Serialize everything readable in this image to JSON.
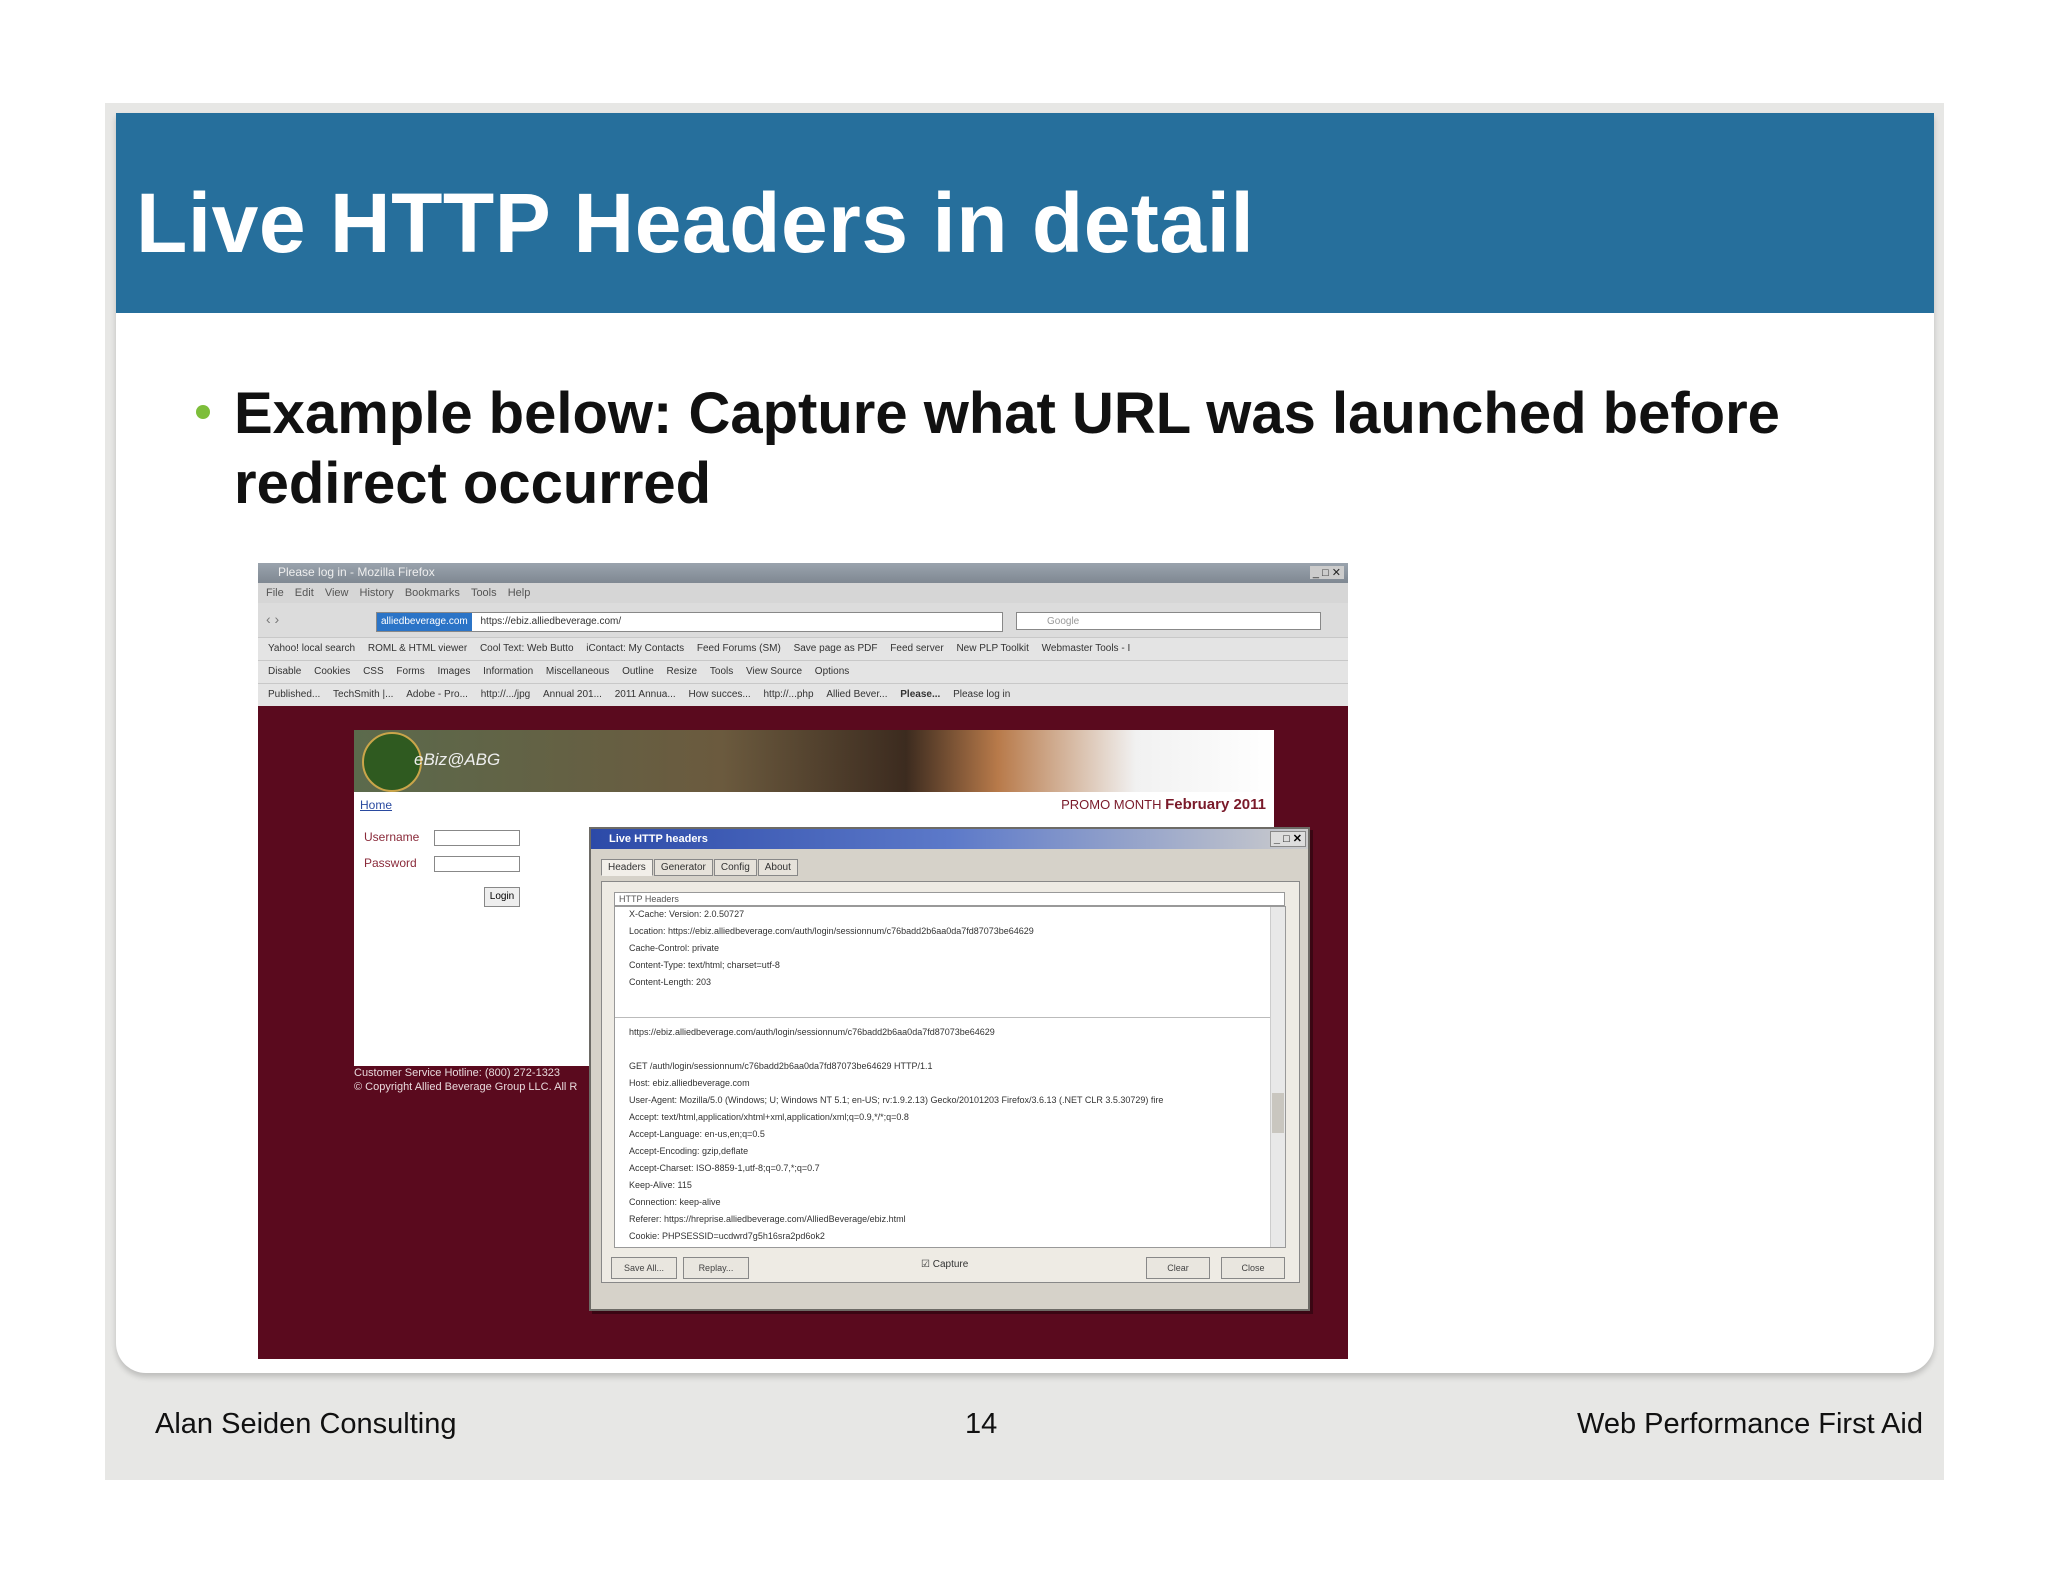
{
  "slide": {
    "title": "Live HTTP Headers in detail",
    "bullet": "Example below: Capture what URL was launched before redirect occurred",
    "footer_left": "Alan Seiden Consulting",
    "page_number": "14",
    "footer_right": "Web Performance First Aid"
  },
  "browser": {
    "window_title": "Please log in - Mozilla Firefox",
    "menu": [
      "File",
      "Edit",
      "View",
      "History",
      "Bookmarks",
      "Tools",
      "Help"
    ],
    "url_site": "alliedbeverage.com",
    "url_path": "https://ebiz.alliedbeverage.com/",
    "search_placeholder": "Google",
    "bookmarks": [
      "Yahoo! local search",
      "ROML & HTML viewer",
      "Cool Text: Web Butto",
      "iContact: My Contacts",
      "Feed Forums (SM)",
      "Save page as PDF",
      "Feed server",
      "New PLP Toolkit",
      "Webmaster Tools - I"
    ],
    "webdev_toolbar": [
      "Disable",
      "Cookies",
      "CSS",
      "Forms",
      "Images",
      "Information",
      "Miscellaneous",
      "Outline",
      "Resize",
      "Tools",
      "View Source",
      "Options"
    ],
    "tabs": [
      "Published...",
      "TechSmith |...",
      "Adobe - Pro...",
      "http://.../jpg",
      "Annual 201...",
      "2011 Annua...",
      "How succes...",
      "http://...php",
      "Allied Bever...",
      "Please...",
      "Please log in"
    ]
  },
  "webpage": {
    "logo_text": "eBiz@ABG",
    "home_link": "Home",
    "month_prefix": "PROMO MONTH",
    "month": "February 2011",
    "username_label": "Username",
    "password_label": "Password",
    "login_button": "Login",
    "footer_line1": "Customer Service Hotline: (800) 272-1323",
    "footer_line2": "© Copyright Allied Beverage Group LLC. All R"
  },
  "dialog": {
    "title": "Live HTTP headers",
    "tabs": [
      "Headers",
      "Generator",
      "Config",
      "About"
    ],
    "section_label": "HTTP Headers",
    "lines_top": [
      "X-Cache: Version: 2.0.50727",
      "Location: https://ebiz.alliedbeverage.com/auth/login/sessionnum/c76badd2b6aa0da7fd87073be64629",
      "Cache-Control: private",
      "Content-Type: text/html; charset=utf-8",
      "Content-Length: 203"
    ],
    "lines_bottom": [
      "https://ebiz.alliedbeverage.com/auth/login/sessionnum/c76badd2b6aa0da7fd87073be64629",
      "",
      "GET /auth/login/sessionnum/c76badd2b6aa0da7fd87073be64629 HTTP/1.1",
      "Host: ebiz.alliedbeverage.com",
      "User-Agent: Mozilla/5.0 (Windows; U; Windows NT 5.1; en-US; rv:1.9.2.13) Gecko/20101203 Firefox/3.6.13 (.NET CLR 3.5.30729) fire",
      "Accept: text/html,application/xhtml+xml,application/xml;q=0.9,*/*;q=0.8",
      "Accept-Language: en-us,en;q=0.5",
      "Accept-Encoding: gzip,deflate",
      "Accept-Charset: ISO-8859-1,utf-8;q=0.7,*;q=0.7",
      "Keep-Alive: 115",
      "Connection: keep-alive",
      "Referer: https://hreprise.alliedbeverage.com/AlliedBeverage/ebiz.html",
      "Cookie: PHPSESSID=ucdwrd7g5h16sra2pd6ok2"
    ],
    "save_all": "Save All...",
    "replay": "Replay...",
    "capture_label": "Capture",
    "clear": "Clear",
    "close": "Close"
  },
  "colors": {
    "title_bar": "#266f9c",
    "bullet": "#7dbe3a",
    "maroon_page": "#5a0a1e"
  }
}
